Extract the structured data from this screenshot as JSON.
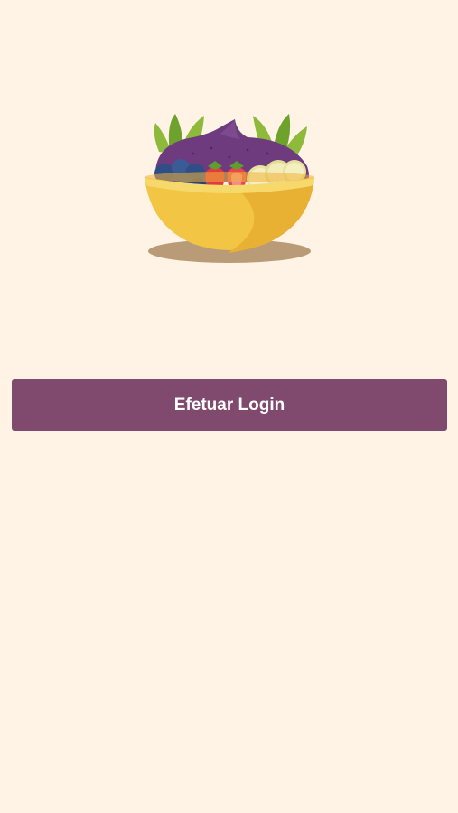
{
  "screen": {
    "background_color": "#FEF3E4"
  },
  "logo": {
    "icon": "acai-bowl-icon"
  },
  "login_button": {
    "label": "Efetuar Login",
    "background_color": "#804A6E",
    "text_color": "#FFFFFF"
  }
}
